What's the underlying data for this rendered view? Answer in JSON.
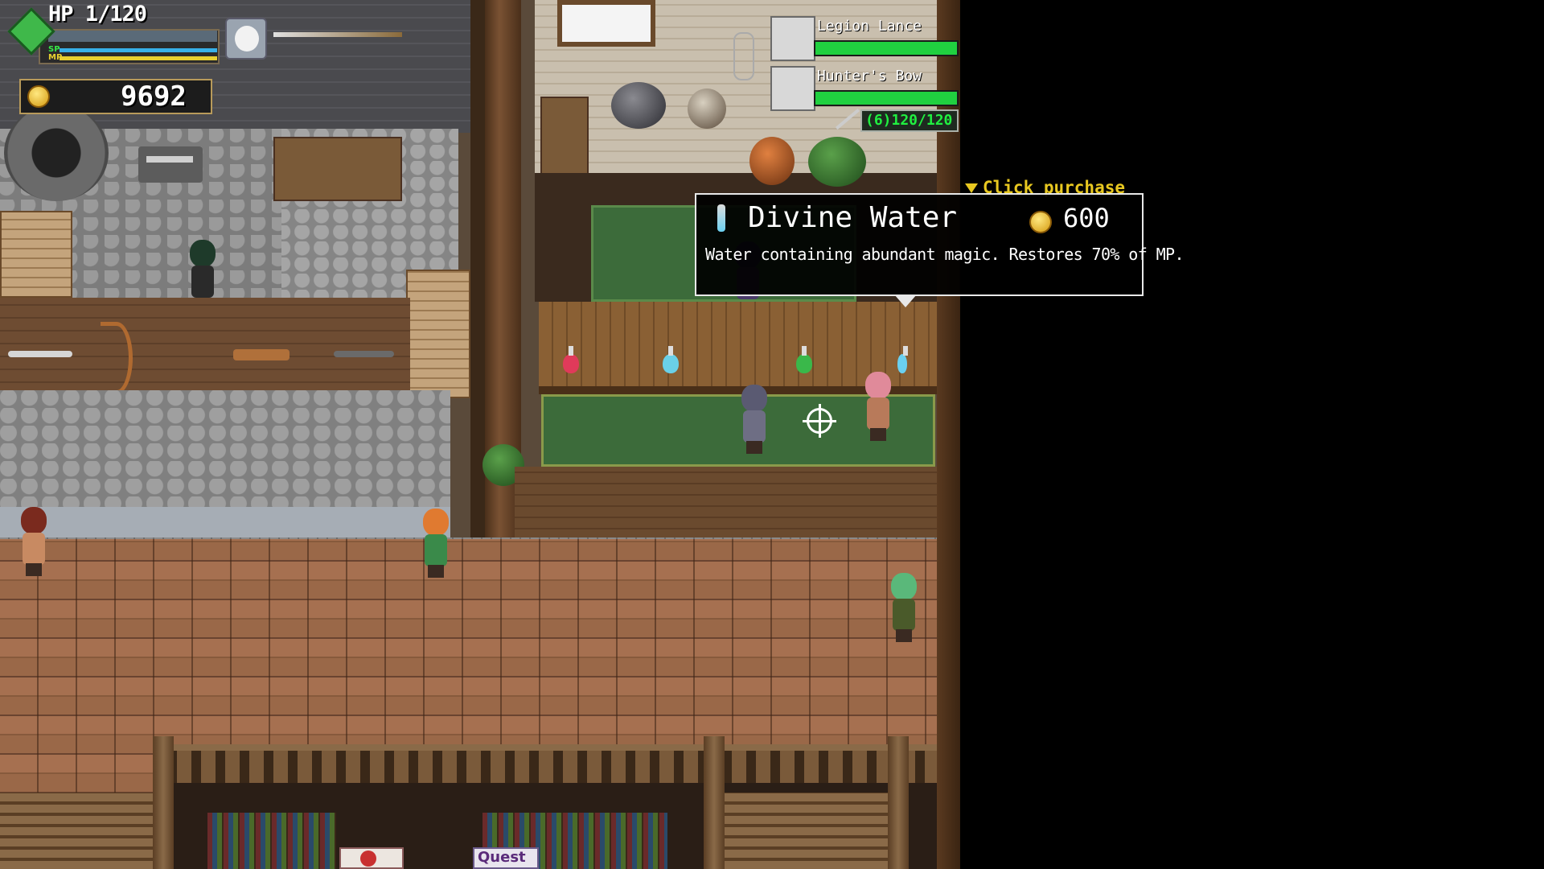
{
  "hud": {
    "hp_label": "HP",
    "hp_value": "1/120",
    "sp_label": "SP",
    "mp_label": "MP",
    "gold": "9692"
  },
  "weapons": [
    {
      "name": "Legion Lance",
      "durability_fraction": 1.0
    },
    {
      "name": "Hunter's Bow",
      "durability_fraction": 1.0
    }
  ],
  "ammo": "(6)120/120",
  "tooltip": {
    "item_name": "Divine Water",
    "price": "600",
    "description": "Water containing abundant magic. Restores 70% of MP.",
    "hint": "Click purchase"
  },
  "lower_room": {
    "quest_label": "Quest"
  },
  "colors": {
    "hp_gem": "#3fb84a",
    "sp_bar": "#38b0e8",
    "mp_bar": "#e8d030",
    "durability_bar": "#20d040",
    "ammo_text": "#20f040",
    "hint_text": "#e8c820"
  },
  "icons": [
    "gem-icon",
    "pet-icon",
    "spear-icon",
    "coin-icon",
    "lance-icon",
    "bow-icon",
    "arrow-icon",
    "weapon-switch-icon",
    "potion-icon",
    "crosshair-icon"
  ]
}
